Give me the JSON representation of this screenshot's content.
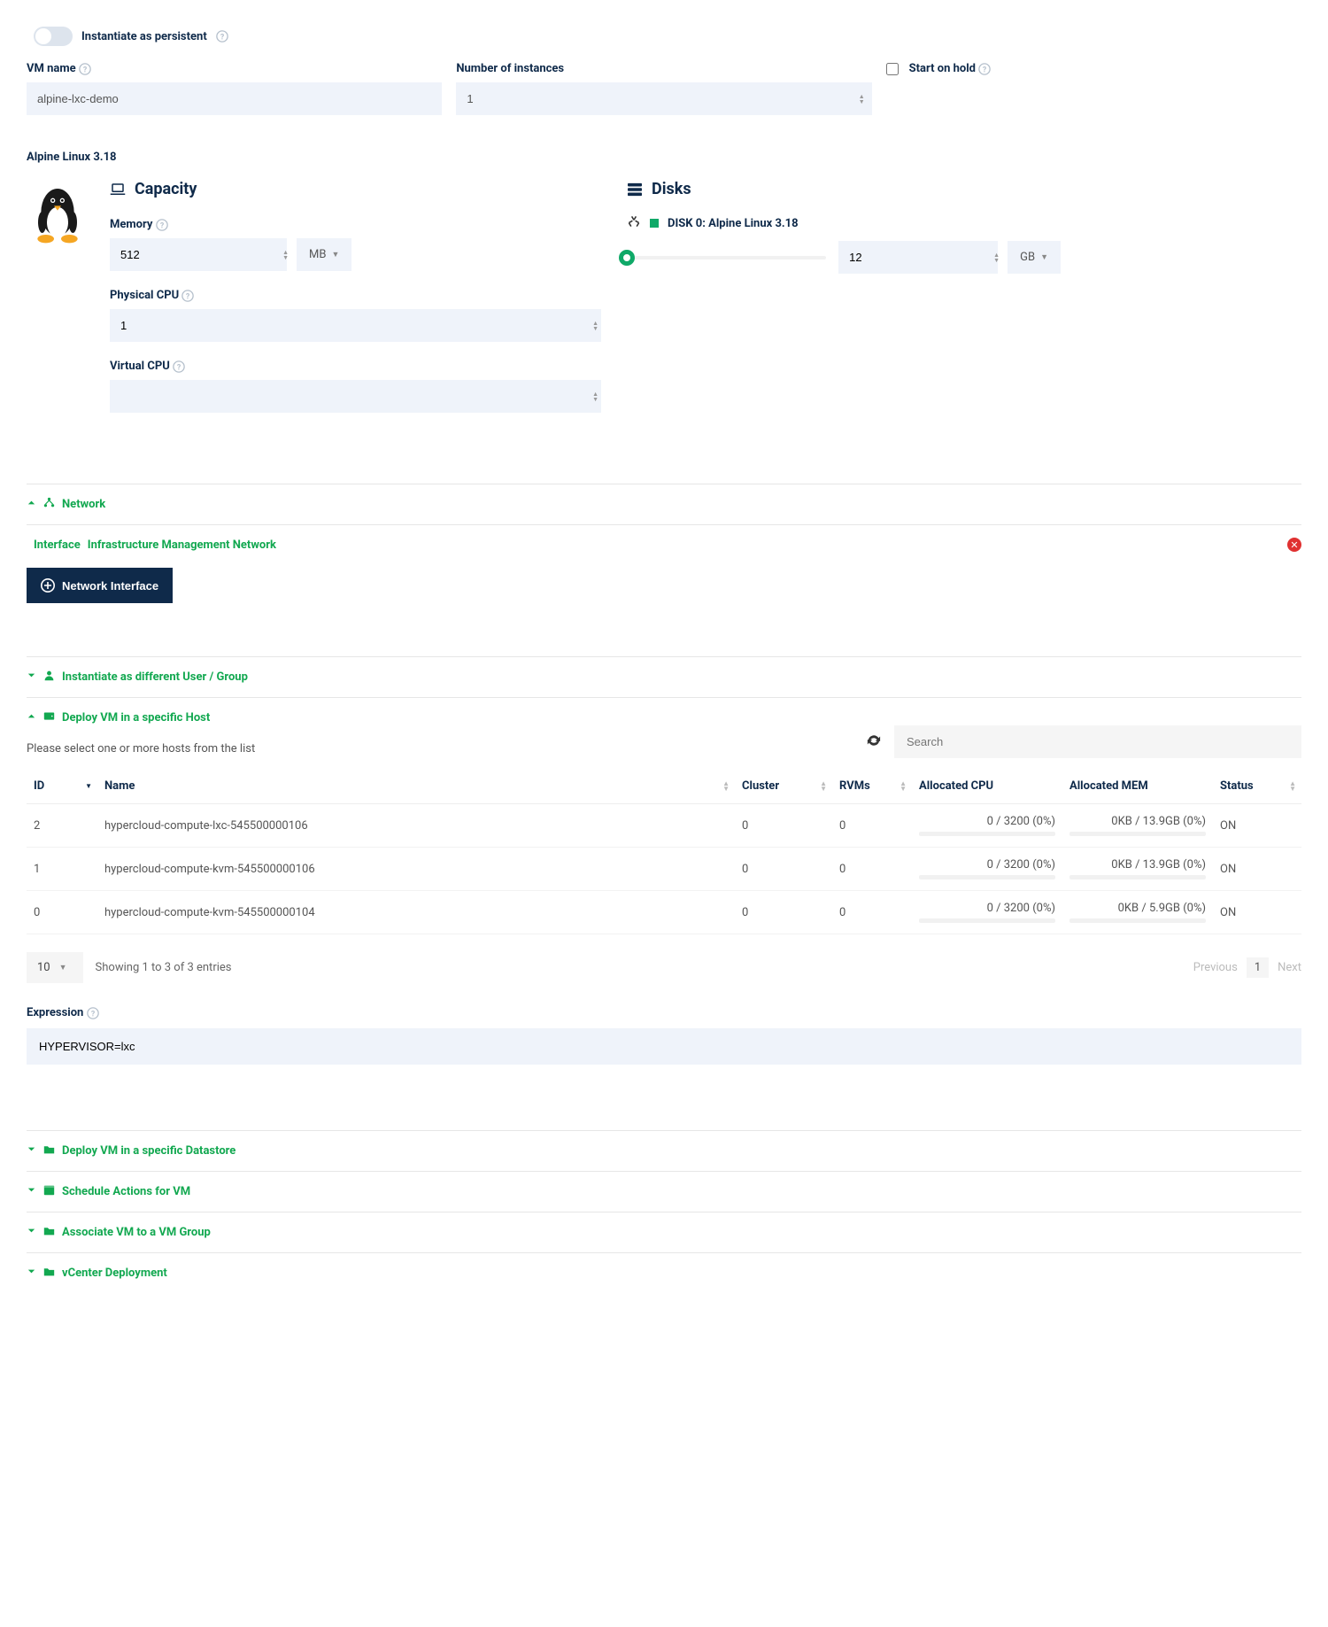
{
  "persistent": {
    "label": "Instantiate as persistent"
  },
  "form": {
    "vm_name_label": "VM name",
    "vm_name_value": "alpine-lxc-demo",
    "num_instances_label": "Number of instances",
    "num_instances_value": "1",
    "start_on_hold_label": "Start on hold"
  },
  "template": {
    "name": "Alpine Linux 3.18"
  },
  "capacity": {
    "title": "Capacity",
    "memory_label": "Memory",
    "memory_value": "512",
    "memory_unit": "MB",
    "pcpu_label": "Physical CPU",
    "pcpu_value": "1",
    "vcpu_label": "Virtual CPU",
    "vcpu_value": ""
  },
  "disks": {
    "title": "Disks",
    "disk0_label": "DISK 0: Alpine Linux 3.18",
    "disk0_size": "12",
    "disk0_unit": "GB"
  },
  "sections": {
    "network": "Network",
    "interface_prefix": "Interface",
    "interface_name": "Infrastructure Management Network",
    "add_nic_button": "Network Interface",
    "diff_user": "Instantiate as different User / Group",
    "deploy_host": "Deploy VM in a specific Host",
    "deploy_ds": "Deploy VM in a specific Datastore",
    "schedule": "Schedule Actions for VM",
    "vm_group": "Associate VM to a VM Group",
    "vcenter": "vCenter Deployment"
  },
  "hosts": {
    "hint": "Please select one or more hosts from the list",
    "search_placeholder": "Search",
    "columns": {
      "id": "ID",
      "name": "Name",
      "cluster": "Cluster",
      "rvms": "RVMs",
      "alloc_cpu": "Allocated CPU",
      "alloc_mem": "Allocated MEM",
      "status": "Status"
    },
    "rows": [
      {
        "id": "2",
        "name": "hypercloud-compute-lxc-545500000106",
        "cluster": "0",
        "rvms": "0",
        "cpu": "0 / 3200 (0%)",
        "mem": "0KB / 13.9GB (0%)",
        "status": "ON"
      },
      {
        "id": "1",
        "name": "hypercloud-compute-kvm-545500000106",
        "cluster": "0",
        "rvms": "0",
        "cpu": "0 / 3200 (0%)",
        "mem": "0KB / 13.9GB (0%)",
        "status": "ON"
      },
      {
        "id": "0",
        "name": "hypercloud-compute-kvm-545500000104",
        "cluster": "0",
        "rvms": "0",
        "cpu": "0 / 3200 (0%)",
        "mem": "0KB / 5.9GB (0%)",
        "status": "ON"
      }
    ],
    "page_size": "10",
    "info": "Showing 1 to 3 of 3 entries",
    "prev": "Previous",
    "page": "1",
    "next": "Next"
  },
  "expression": {
    "label": "Expression",
    "value": "HYPERVISOR=lxc"
  }
}
